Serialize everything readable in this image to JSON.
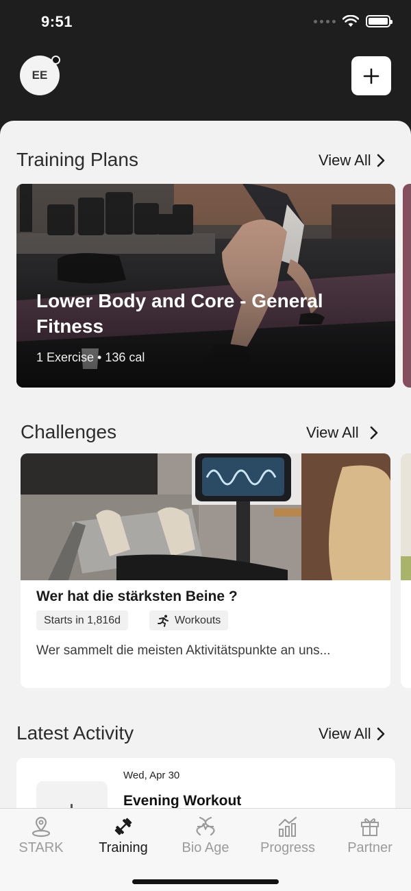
{
  "status_bar": {
    "time": "9:51"
  },
  "header": {
    "avatar_initials": "EE"
  },
  "training_plans": {
    "title": "Training Plans",
    "view_all": "View All",
    "card": {
      "title": "Lower Body and Core - General Fitness",
      "meta": "1 Exercise • 136 cal"
    }
  },
  "challenges": {
    "title": "Challenges",
    "view_all": "View All",
    "card": {
      "title": "Wer hat die stärksten Beine ?",
      "chip_starts": "Starts in 1,816d",
      "chip_type": "Workouts",
      "description": "Wer sammelt die meisten Aktivitätspunkte an uns..."
    }
  },
  "latest_activity": {
    "title": "Latest Activity",
    "view_all": "View All",
    "card": {
      "date": "Wed, Apr 30",
      "title": "Evening Workout"
    }
  },
  "tabbar": {
    "tabs": [
      {
        "label": "STARK",
        "icon": "location-pin-icon",
        "active": false
      },
      {
        "label": "Training",
        "icon": "dumbbell-icon",
        "active": true
      },
      {
        "label": "Bio Age",
        "icon": "bio-age-icon",
        "active": false
      },
      {
        "label": "Progress",
        "icon": "bar-chart-icon",
        "active": false
      },
      {
        "label": "Partner",
        "icon": "gift-icon",
        "active": false
      }
    ]
  }
}
